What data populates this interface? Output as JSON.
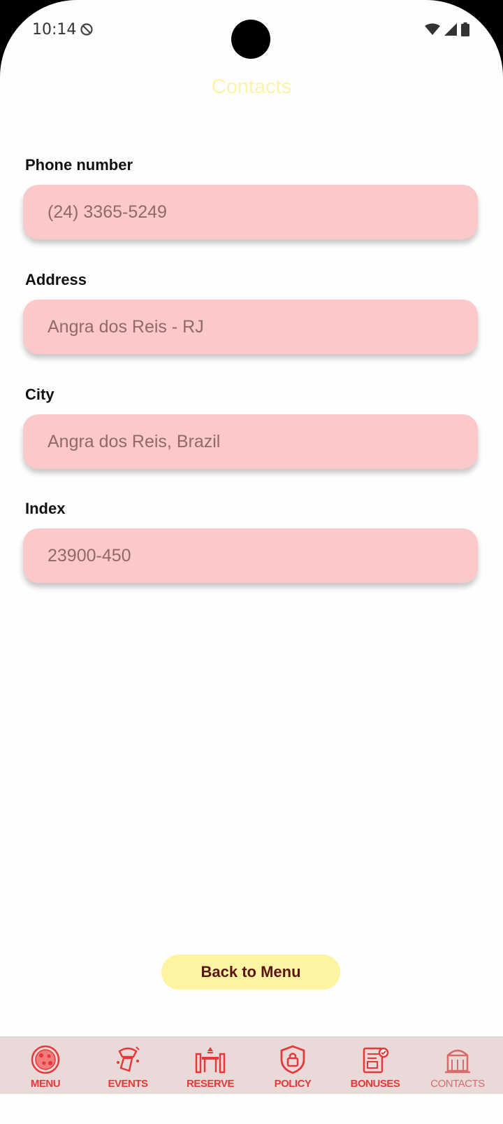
{
  "status_bar": {
    "time": "10:14"
  },
  "header": {
    "title": "Contacts"
  },
  "fields": [
    {
      "label": "Phone number",
      "placeholder": "(24) 3365-5249"
    },
    {
      "label": "Address",
      "placeholder": "Angra dos Reis - RJ"
    },
    {
      "label": "City",
      "placeholder": "Angra dos Reis, Brazil"
    },
    {
      "label": "Index",
      "placeholder": "23900-450"
    }
  ],
  "back_button": {
    "label": "Back to Menu"
  },
  "nav": {
    "items": [
      {
        "label": "MENU",
        "icon": "pizza-icon"
      },
      {
        "label": "EVENTS",
        "icon": "party-icon"
      },
      {
        "label": "RESERVE",
        "icon": "table-icon"
      },
      {
        "label": "POLICY",
        "icon": "shield-lock-icon"
      },
      {
        "label": "BONUSES",
        "icon": "coupon-icon"
      },
      {
        "label": "CONTACTS",
        "icon": "building-icon"
      }
    ],
    "active": "CONTACTS"
  },
  "colors": {
    "accent": "#e53939",
    "field_bg": "#fcc9ca",
    "title": "#fdf4a8",
    "button_bg": "#fdf4a1",
    "nav_bg": "#e9d9d9"
  }
}
